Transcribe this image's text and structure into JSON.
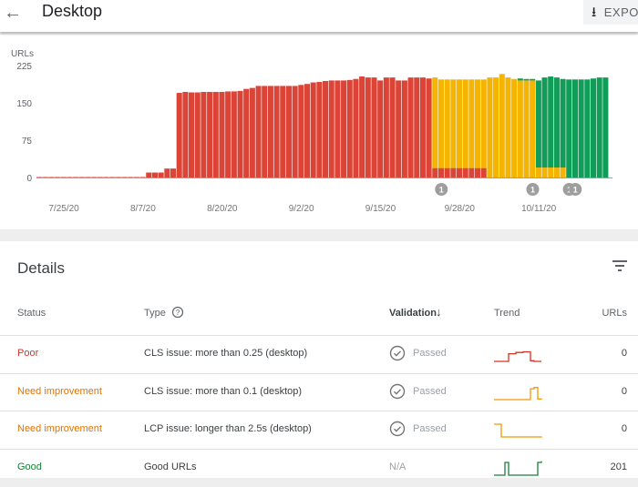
{
  "header": {
    "title": "Desktop",
    "back_icon": "arrow-left-icon",
    "export_label": "EXPO",
    "export_icon": "download-icon"
  },
  "chart_data": {
    "type": "bar",
    "stacked": true,
    "ylabel": "URLs",
    "ylim": [
      0,
      225
    ],
    "yticks": [
      "0",
      "75",
      "150",
      "225"
    ],
    "xticks": [
      "7/25/20",
      "8/7/20",
      "8/20/20",
      "9/2/20",
      "9/15/20",
      "9/28/20",
      "10/11/20"
    ],
    "start_date": "7/21/20",
    "colors": {
      "poor": "#db4437",
      "need_improvement": "#f4b400",
      "good": "#0f9d58"
    },
    "series": [
      {
        "key": "poor",
        "values": [
          1,
          1,
          1,
          1,
          1,
          1,
          1,
          1,
          1,
          1,
          1,
          1,
          1,
          1,
          1,
          1,
          1,
          1,
          10,
          10,
          10,
          18,
          18,
          170,
          172,
          171,
          171,
          172,
          172,
          172,
          172,
          173,
          173,
          174,
          178,
          180,
          184,
          184,
          184,
          184,
          184,
          184,
          184,
          186,
          188,
          191,
          192,
          194,
          195,
          195,
          195,
          196,
          198,
          203,
          201,
          201,
          195,
          201,
          201,
          195,
          195,
          201,
          201,
          201,
          199,
          19,
          19,
          19,
          19,
          19,
          19,
          19,
          19,
          19,
          0,
          0,
          0,
          0,
          0,
          0,
          0,
          0,
          0,
          0,
          0,
          0,
          0,
          0,
          0,
          0,
          0,
          0,
          0,
          0
        ]
      },
      {
        "key": "need_improvement",
        "values": [
          0,
          0,
          0,
          0,
          0,
          0,
          0,
          0,
          0,
          0,
          0,
          0,
          0,
          0,
          0,
          0,
          0,
          0,
          0,
          0,
          0,
          0,
          0,
          0,
          0,
          0,
          0,
          0,
          0,
          0,
          0,
          0,
          0,
          0,
          0,
          0,
          0,
          0,
          0,
          0,
          0,
          0,
          0,
          0,
          0,
          0,
          0,
          0,
          0,
          0,
          0,
          0,
          0,
          0,
          0,
          0,
          0,
          0,
          0,
          0,
          0,
          0,
          0,
          0,
          0,
          182,
          178,
          178,
          178,
          178,
          178,
          178,
          178,
          178,
          201,
          201,
          208,
          201,
          198,
          195,
          195,
          195,
          20,
          20,
          20,
          20,
          20,
          0,
          0,
          0,
          0,
          0,
          0,
          0,
          0
        ]
      },
      {
        "key": "good",
        "values": [
          0,
          0,
          0,
          0,
          0,
          0,
          0,
          0,
          0,
          0,
          0,
          0,
          0,
          0,
          0,
          0,
          0,
          0,
          0,
          0,
          0,
          0,
          0,
          0,
          0,
          0,
          0,
          0,
          0,
          0,
          0,
          0,
          0,
          0,
          0,
          0,
          0,
          0,
          0,
          0,
          0,
          0,
          0,
          0,
          0,
          0,
          0,
          0,
          0,
          0,
          0,
          0,
          0,
          0,
          0,
          0,
          0,
          0,
          0,
          0,
          0,
          0,
          0,
          0,
          0,
          0,
          0,
          0,
          0,
          0,
          0,
          0,
          0,
          0,
          0,
          0,
          0,
          0,
          0,
          4,
          3,
          3,
          175,
          181,
          183,
          181,
          178,
          197,
          197,
          197,
          197,
          199,
          201,
          201,
          201
        ]
      }
    ],
    "annotations": [
      {
        "date": "9/25/20",
        "label": "1"
      },
      {
        "date": "10/10/20",
        "label": "1"
      },
      {
        "date": "10/16/20",
        "label": "1"
      },
      {
        "date": "10/17/20",
        "label": "1"
      }
    ]
  },
  "details": {
    "title": "Details",
    "filter_icon": "filter-icon",
    "columns": {
      "status": "Status",
      "type": "Type",
      "validation": "Validation",
      "trend": "Trend",
      "urls": "URLs"
    },
    "rows": [
      {
        "status": "Poor",
        "status_color": "#d93025",
        "type": "CLS issue: more than 0.25 (desktop)",
        "validation": "Passed",
        "trend_color": "#d93025",
        "trend": [
          0,
          0,
          0,
          0,
          0.6,
          0.6,
          0.7,
          0.7,
          0.75,
          0.75,
          0.05,
          0,
          0,
          0
        ],
        "urls": "0"
      },
      {
        "status": "Need improvement",
        "status_color": "#e37400",
        "type": "CLS issue: more than 0.1 (desktop)",
        "validation": "Passed",
        "trend_color": "#f29900",
        "trend": [
          0,
          0,
          0,
          0,
          0,
          0,
          0,
          0,
          0,
          0,
          0.85,
          0.95,
          0.05,
          0
        ],
        "urls": "0"
      },
      {
        "status": "Need improvement",
        "status_color": "#e37400",
        "type": "LCP issue: longer than 2.5s (desktop)",
        "validation": "Passed",
        "trend_color": "#f29900",
        "trend": [
          1,
          1,
          0,
          0,
          0,
          0,
          0,
          0,
          0,
          0,
          0,
          0,
          0,
          -0.05
        ],
        "urls": "0"
      },
      {
        "status": "Good",
        "status_color": "#188038",
        "type": "Good URLs",
        "validation": "N/A",
        "trend_color": "#188038",
        "trend": [
          0,
          0,
          0,
          1,
          0,
          0,
          0,
          0,
          0,
          0,
          0,
          0,
          1,
          1.1
        ],
        "urls": "201"
      }
    ]
  }
}
